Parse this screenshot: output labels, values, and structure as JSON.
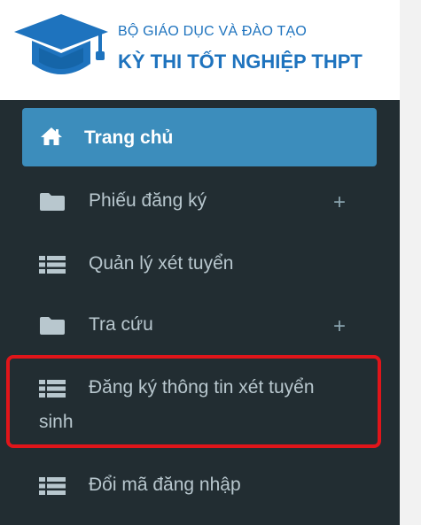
{
  "header": {
    "org": "BỘ GIÁO DỤC VÀ ĐÀO TẠO",
    "title": "KỲ THI TỐT NGHIỆP THPT",
    "logo_icon": "graduation-cap-icon"
  },
  "colors": {
    "brand": "#1e73be",
    "sidebar_bg": "#222d32",
    "active_bg": "#3c8dbc",
    "highlight": "#e0151a"
  },
  "sidebar": {
    "items": [
      {
        "label": "Trang chủ",
        "icon": "home-icon",
        "active": true
      },
      {
        "label": "Phiếu đăng ký",
        "icon": "folder-icon",
        "expand": "+"
      },
      {
        "label": "Quản lý xét tuyển",
        "icon": "list-icon"
      },
      {
        "label": "Tra cứu",
        "icon": "folder-icon",
        "expand": "+"
      },
      {
        "label_line1": "Đăng ký thông tin xét tuyển",
        "label_line2": "sinh",
        "icon": "list-icon",
        "highlighted": true
      },
      {
        "label": "Đổi mã đăng nhập",
        "icon": "list-icon"
      }
    ]
  }
}
